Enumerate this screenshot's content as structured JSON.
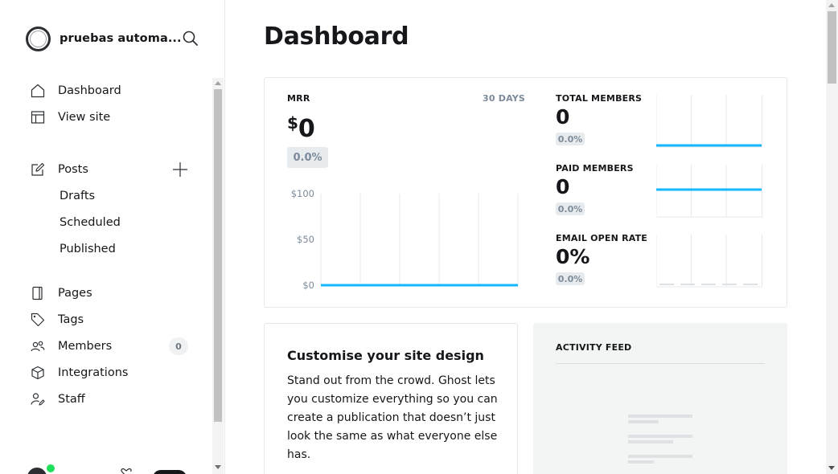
{
  "sidebar": {
    "site_name": "pruebas automa...",
    "nav": [
      {
        "label": "Dashboard",
        "icon": "home-icon"
      },
      {
        "label": "View site",
        "icon": "layout-icon"
      }
    ],
    "posts": {
      "label": "Posts",
      "icon": "edit-icon",
      "add_icon": "plus-icon",
      "sub_items": [
        "Drafts",
        "Scheduled",
        "Published"
      ]
    },
    "nav_secondary": [
      {
        "label": "Pages",
        "icon": "page-icon"
      },
      {
        "label": "Tags",
        "icon": "tag-icon"
      },
      {
        "label": "Members",
        "icon": "members-icon",
        "badge": "0"
      },
      {
        "label": "Integrations",
        "icon": "box-icon"
      },
      {
        "label": "Staff",
        "icon": "staff-icon"
      }
    ]
  },
  "main": {
    "title": "Dashboard"
  },
  "stats": {
    "mrr": {
      "label": "MRR",
      "period": "30 DAYS",
      "currency": "$",
      "value": "0",
      "change": "0.0%"
    },
    "metrics": [
      {
        "label": "TOTAL MEMBERS",
        "value": "0",
        "change": "0.0%"
      },
      {
        "label": "PAID MEMBERS",
        "value": "0",
        "change": "0.0%"
      },
      {
        "label": "EMAIL OPEN RATE",
        "value": "0%",
        "change": "0.0%"
      }
    ]
  },
  "chart_data": {
    "type": "line",
    "ylim": [
      0,
      100
    ],
    "yticks": [
      "$100",
      "$50",
      "$0"
    ],
    "series": [
      {
        "values": [
          0,
          0,
          0,
          0,
          0,
          0
        ]
      }
    ],
    "grid": true
  },
  "design_card": {
    "title": "Customise your site design",
    "text": "Stand out from the crowd. Ghost lets you customize everything so you can create a publication that doesn’t just look the same as what everyone else has."
  },
  "activity": {
    "title": "ACTIVITY FEED"
  },
  "colors": {
    "accent_line": "#14b8ff",
    "online": "#1ee05a"
  }
}
